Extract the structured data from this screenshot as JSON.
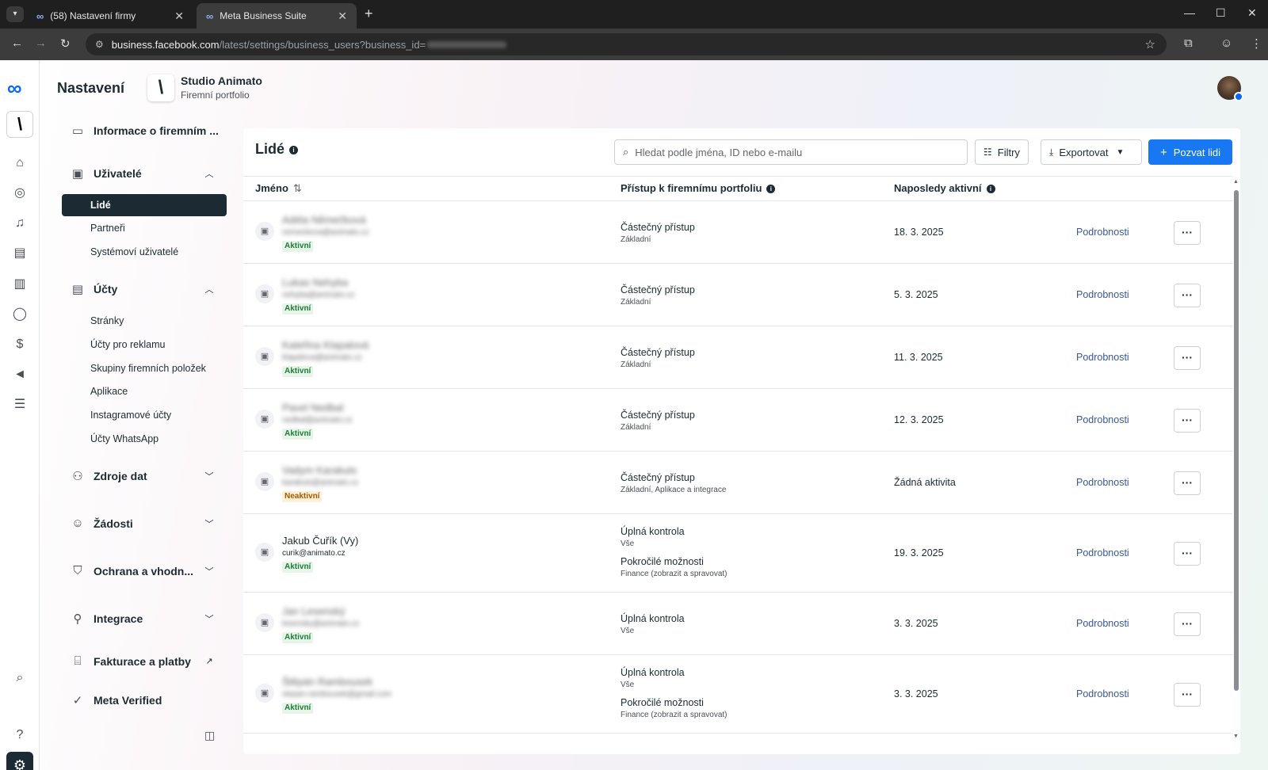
{
  "browser": {
    "tabs": [
      {
        "title": "(58) Nastavení firmy"
      },
      {
        "title": "Meta Business Suite"
      }
    ],
    "url_domain": "business.facebook.com",
    "url_path": "/latest/settings/business_users?business_id="
  },
  "header": {
    "title": "Nastavení",
    "business_name": "Studio Animato",
    "business_sub": "Firemní portfolio"
  },
  "menu": {
    "info": "Informace o firemním ...",
    "users": "Uživatelé",
    "users_items": [
      "Lidé",
      "Partneři",
      "Systémoví uživatelé"
    ],
    "accounts": "Účty",
    "accounts_items": [
      "Stránky",
      "Účty pro reklamu",
      "Skupiny firemních položek",
      "Aplikace",
      "Instagramové účty",
      "Účty WhatsApp"
    ],
    "data_sources": "Zdroje dat",
    "requests": "Žádosti",
    "protection": "Ochrana a vhodn...",
    "integrations": "Integrace",
    "billing": "Fakturace a platby",
    "meta_verified": "Meta Verified"
  },
  "people": {
    "title": "Lidé",
    "search_placeholder": "Hledat podle jména, ID nebo e-mailu",
    "filters": "Filtry",
    "export": "Exportovat",
    "invite": "Pozvat lidi",
    "columns": {
      "name": "Jméno",
      "access": "Přístup k firemnímu portfoliu",
      "last_active": "Naposledy aktivní"
    },
    "details_label": "Podrobnosti",
    "rows": [
      {
        "name": "Adéla Němečková",
        "email": "nemeckova@animato.cz",
        "status": "Aktivní",
        "access": "Částečný přístup",
        "access_sub": "Základní",
        "access2": "",
        "access2_sub": "",
        "last": "18. 3. 2025"
      },
      {
        "name": "Lukas Nehyba",
        "email": "nehyba@animato.cz",
        "status": "Aktivní",
        "access": "Částečný přístup",
        "access_sub": "Základní",
        "access2": "",
        "access2_sub": "",
        "last": "5. 3. 2025"
      },
      {
        "name": "Kateřina Klapalová",
        "email": "klapalova@animato.cz",
        "status": "Aktivní",
        "access": "Částečný přístup",
        "access_sub": "Základní",
        "access2": "",
        "access2_sub": "",
        "last": "11. 3. 2025"
      },
      {
        "name": "Pavel Nedbal",
        "email": "nedbal@animato.cz",
        "status": "Aktivní",
        "access": "Částečný přístup",
        "access_sub": "Základní",
        "access2": "",
        "access2_sub": "",
        "last": "12. 3. 2025"
      },
      {
        "name": "Vadym Karakuts",
        "email": "karakuts@animato.cz",
        "status": "Neaktivní",
        "access": "Částečný přístup",
        "access_sub": "Základní, Aplikace a integrace",
        "access2": "",
        "access2_sub": "",
        "last": "Žádná aktivita"
      },
      {
        "name": "Jakub Čuřík (Vy)",
        "email": "curik@animato.cz",
        "status": "Aktivní",
        "access": "Úplná kontrola",
        "access_sub": "Vše",
        "access2": "Pokročilé možnosti",
        "access2_sub": "Finance (zobrazit a spravovat)",
        "last": "19. 3. 2025"
      },
      {
        "name": "Jan Lesenský",
        "email": "lesensky@animato.cz",
        "status": "Aktivní",
        "access": "Úplná kontrola",
        "access_sub": "Vše",
        "access2": "",
        "access2_sub": "",
        "last": "3. 3. 2025"
      },
      {
        "name": "Štěpán Rambousek",
        "email": "stepan.rambousek@gmail.com",
        "status": "Aktivní",
        "access": "Úplná kontrola",
        "access_sub": "Vše",
        "access2": "Pokročilé možnosti",
        "access2_sub": "Finance (zobrazit a spravovat)",
        "last": "3. 3. 2025"
      }
    ]
  },
  "colors": {
    "primary": "#1877f2",
    "link": "#385898",
    "dark": "#1c2b33"
  }
}
